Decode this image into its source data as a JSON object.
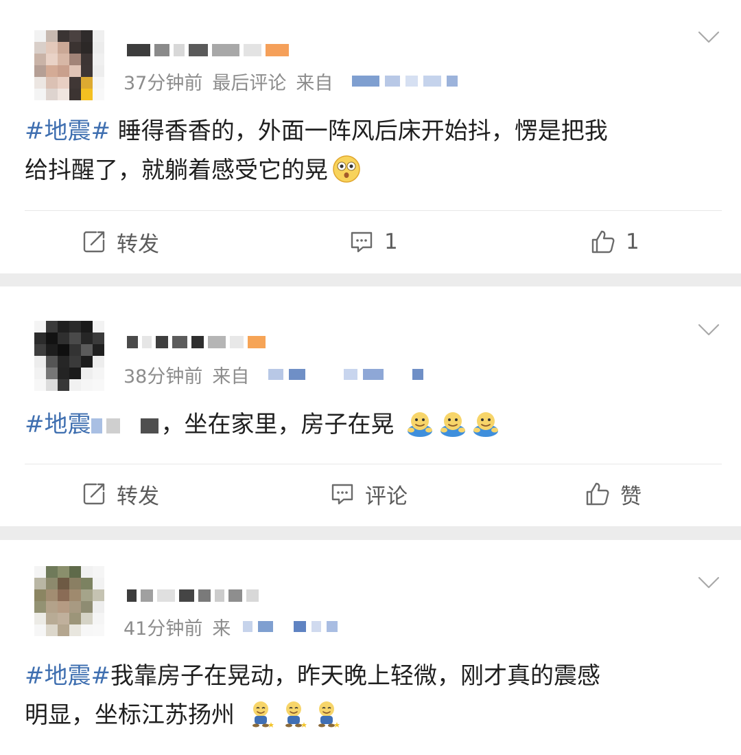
{
  "posts": [
    {
      "time": "37分钟前",
      "extra": "最后评论",
      "source_prefix": "来自",
      "hashtag": "#地震#",
      "text_line1": "睡得香香的，外面一阵风后床开始抖，愣是把我",
      "text_line2": "给抖醒了，就躺着感受它的晃",
      "emoji": "flushed-face",
      "repost_label": "转发",
      "comment_label": "1",
      "like_label": "1"
    },
    {
      "time": "38分钟前",
      "source_prefix": "来自",
      "hashtag": "#地震",
      "text": "，坐在家里，房子在晃",
      "emoji": "doge-hug",
      "emoji_count": 3,
      "repost_label": "转发",
      "comment_label": "评论",
      "like_label": "赞"
    },
    {
      "time": "41分钟前",
      "source_prefix": "来",
      "hashtag": "#地震#",
      "text_line1": "我靠房子在晃动，昨天晚上轻微，刚才真的震感",
      "text_line2": "明显，坐标江苏扬州",
      "emoji": "sitting-doge",
      "emoji_count": 3
    }
  ],
  "colors": {
    "hashtag": "#3f6fb0",
    "meta_text": "#8c8c8c",
    "body_text": "#1f1f1f",
    "action_text": "#5b5b5b",
    "separator": "#ececec",
    "icon_gray": "#7a7a7a"
  }
}
